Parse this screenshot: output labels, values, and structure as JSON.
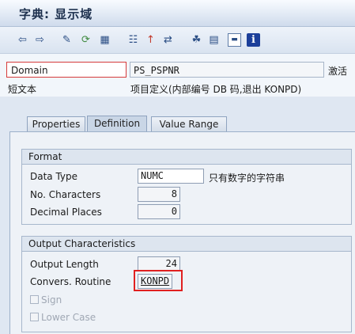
{
  "window": {
    "title": "字典: 显示域"
  },
  "toolbar": {
    "icons": [
      "back-arrow-icon",
      "forward-arrow-icon",
      "edit-pencil-icon",
      "display-change-icon",
      "object-directory-icon",
      "hierarchy-icon",
      "where-used-icon",
      "navigate-icon",
      "display-object-list-icon",
      "print-icon",
      "frame-icon",
      "info-icon"
    ],
    "info_glyph": "i"
  },
  "header": {
    "domain_label": "Domain",
    "domain_value": "PS_PSPNR",
    "status": "激活",
    "short_text_label": "短文本",
    "short_text_value": "项目定义(内部编号 DB 码,退出 KONPD)"
  },
  "tabs": [
    {
      "label": "Properties",
      "active": false
    },
    {
      "label": "Definition",
      "active": true
    },
    {
      "label": "Value Range",
      "active": false
    }
  ],
  "format": {
    "title": "Format",
    "data_type_label": "Data Type",
    "data_type_value": "NUMC",
    "data_type_desc": "只有数字的字符串",
    "no_chars_label": "No. Characters",
    "no_chars_value": "8",
    "decimal_label": "Decimal Places",
    "decimal_value": "0"
  },
  "output": {
    "title": "Output Characteristics",
    "length_label": "Output Length",
    "length_value": "24",
    "conv_label": "Convers. Routine",
    "conv_value": "KONPD",
    "sign_label": "Sign",
    "lowercase_label": "Lower Case"
  },
  "colors": {
    "highlight": "#e02020",
    "title_text": "#1c2f4d"
  }
}
